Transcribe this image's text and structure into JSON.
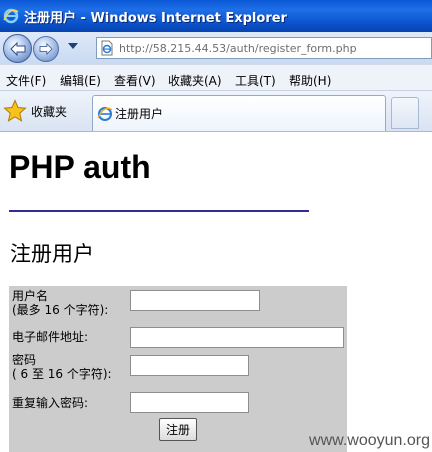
{
  "window": {
    "title": "注册用户 - Windows Internet Explorer"
  },
  "address": {
    "url": "http://58.215.44.53/auth/register_form.php"
  },
  "menu": {
    "items": [
      "文件(F)",
      "编辑(E)",
      "查看(V)",
      "收藏夹(A)",
      "工具(T)",
      "帮助(H)"
    ]
  },
  "favorites": {
    "label": "收藏夹"
  },
  "tabs": [
    {
      "label": "注册用户"
    }
  ],
  "page": {
    "heading": "PHP auth",
    "subheading": "注册用户"
  },
  "form": {
    "username_label": "用户名",
    "username_hint": "(最多  16 个字符):",
    "email_label": "电子邮件地址:",
    "password_label": "密码",
    "password_hint": "( 6 至  16 个字符):",
    "confirm_label": "重复输入密码:",
    "submit_label": "注册"
  },
  "watermark": "www.wooyun.org",
  "colors": {
    "titlebar": "#0b55cf",
    "form_background": "#cccccc",
    "rule": "#2f2f8f"
  }
}
